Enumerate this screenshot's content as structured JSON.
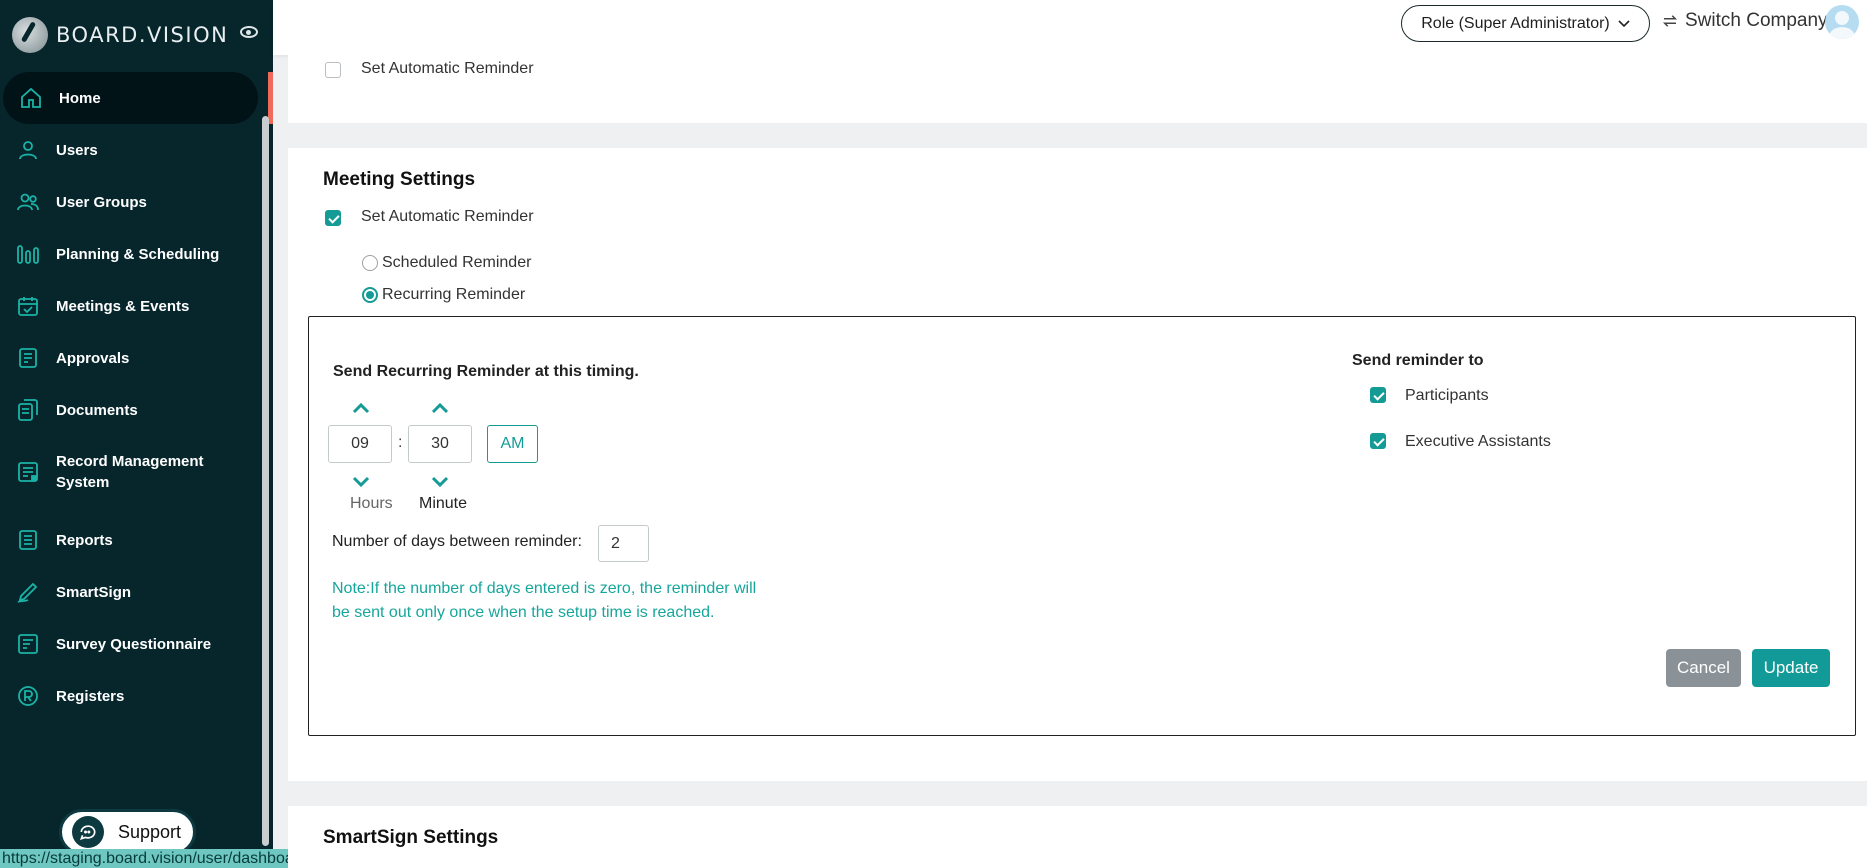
{
  "brand": {
    "name": "BOARD.VISION"
  },
  "sidebar": {
    "items": [
      {
        "label": "Home",
        "icon": "home-icon"
      },
      {
        "label": "Users",
        "icon": "user-icon"
      },
      {
        "label": "User Groups",
        "icon": "user-group-icon"
      },
      {
        "label": "Planning & Scheduling",
        "icon": "planning-bars-icon"
      },
      {
        "label": "Meetings & Events",
        "icon": "calendar-icon"
      },
      {
        "label": "Approvals",
        "icon": "approval-doc-icon"
      },
      {
        "label": "Documents",
        "icon": "documents-icon"
      },
      {
        "label": "Record Management System",
        "icon": "record-management-icon"
      },
      {
        "label": "Reports",
        "icon": "reports-icon"
      },
      {
        "label": "SmartSign",
        "icon": "smartsign-pen-icon"
      },
      {
        "label": "Survey Questionnaire",
        "icon": "survey-icon"
      },
      {
        "label": "Registers",
        "icon": "registered-icon"
      }
    ],
    "support_label": "Support",
    "status_url": "https://staging.board.vision/user/dashboard/admin"
  },
  "header": {
    "role_label": "Role (Super Administrator)",
    "switch_label": "Switch Company"
  },
  "top_card": {
    "reminder_label": "Set Automatic Reminder"
  },
  "meeting": {
    "title": "Meeting Settings",
    "reminder_label": "Set Automatic Reminder",
    "scheduled_label": "Scheduled Reminder",
    "recurring_label": "Recurring Reminder",
    "panel": {
      "title": "Send Recurring Reminder at this timing.",
      "hours_value": "09",
      "minute_value": "30",
      "colon": ":",
      "ampm": "AM",
      "hours_label": "Hours",
      "minute_label": "Minute",
      "days_label": "Number of days between reminder:",
      "days_value": "2",
      "note": "Note:If the number of days entered is zero, the reminder will be sent out only once when the setup time is reached.",
      "send_to_title": "Send reminder to",
      "participants_label": "Participants",
      "assistants_label": "Executive Assistants",
      "cancel_label": "Cancel",
      "update_label": "Update"
    }
  },
  "smartsign": {
    "title": "SmartSign Settings"
  },
  "colors": {
    "accent": "#159b95",
    "sidebar": "#06262c",
    "active_bar": "#f06a59",
    "note": "#17a69b"
  }
}
